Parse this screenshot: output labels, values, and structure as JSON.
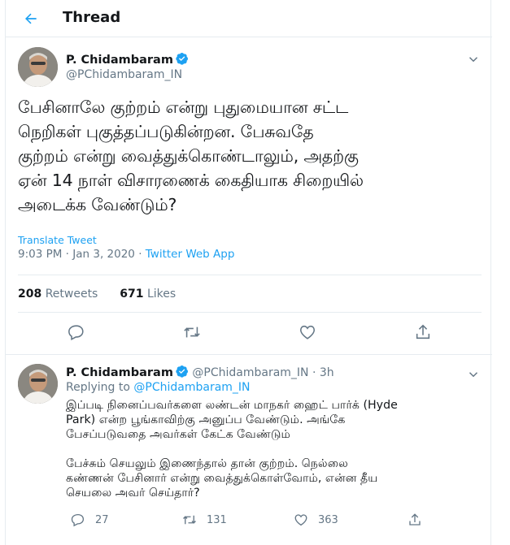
{
  "header": {
    "title": "Thread",
    "back_icon": "back-arrow-icon"
  },
  "main_tweet": {
    "author_name": "P. Chidambaram",
    "author_handle": "@PChidambaram_IN",
    "verified": true,
    "text_lines": [
      "பேசினாலே குற்றம் என்று புதுமையான சட்ட",
      "நெறிகள் புகுத்தப்படுகின்றன. பேசுவதே",
      "குற்றம் என்று வைத்துக்கொண்டாலும், அதற்கு",
      "ஏன் 14 நாள் விசாரணைக் கைதியாக சிறையில்",
      "அடைக்க வேண்டும்?"
    ],
    "translate_label": "Translate Tweet",
    "timestamp": "9:03 PM · Jan 3, 2020 · ",
    "source": "Twitter Web App",
    "retweets_count": "208",
    "retweets_label": "Retweets",
    "likes_count": "671",
    "likes_label": "Likes"
  },
  "reply_tweet": {
    "author_name": "P. Chidambaram",
    "author_handle": "@PChidambaram_IN",
    "time": "· 3h",
    "replying_label": "Replying to ",
    "replying_to": "@PChidambaram_IN",
    "paragraph1_lines": [
      "இப்படி நினைப்பவர்களை லண்டன் மாநகர் ஹைட் பார்க் (Hyde",
      "Park) என்ற பூங்காவிற்கு அனுப்ப வேண்டும். அங்கே",
      "பேசப்படுவதை அவர்கள் கேட்க வேண்டும்"
    ],
    "paragraph2_lines": [
      "பேச்சும் செயலும் இணைந்தால் தான் குற்றம். நெல்லை",
      "கண்ணன் பேசினார் என்று வைத்துக்கொள்வோம், என்ன தீய",
      "செயலை அவர் செய்தார்?"
    ],
    "replies_count": "27",
    "retweets_count": "131",
    "likes_count": "363"
  },
  "colors": {
    "accent": "#1da1f2",
    "muted": "#657786",
    "border": "#e6ecf0"
  }
}
